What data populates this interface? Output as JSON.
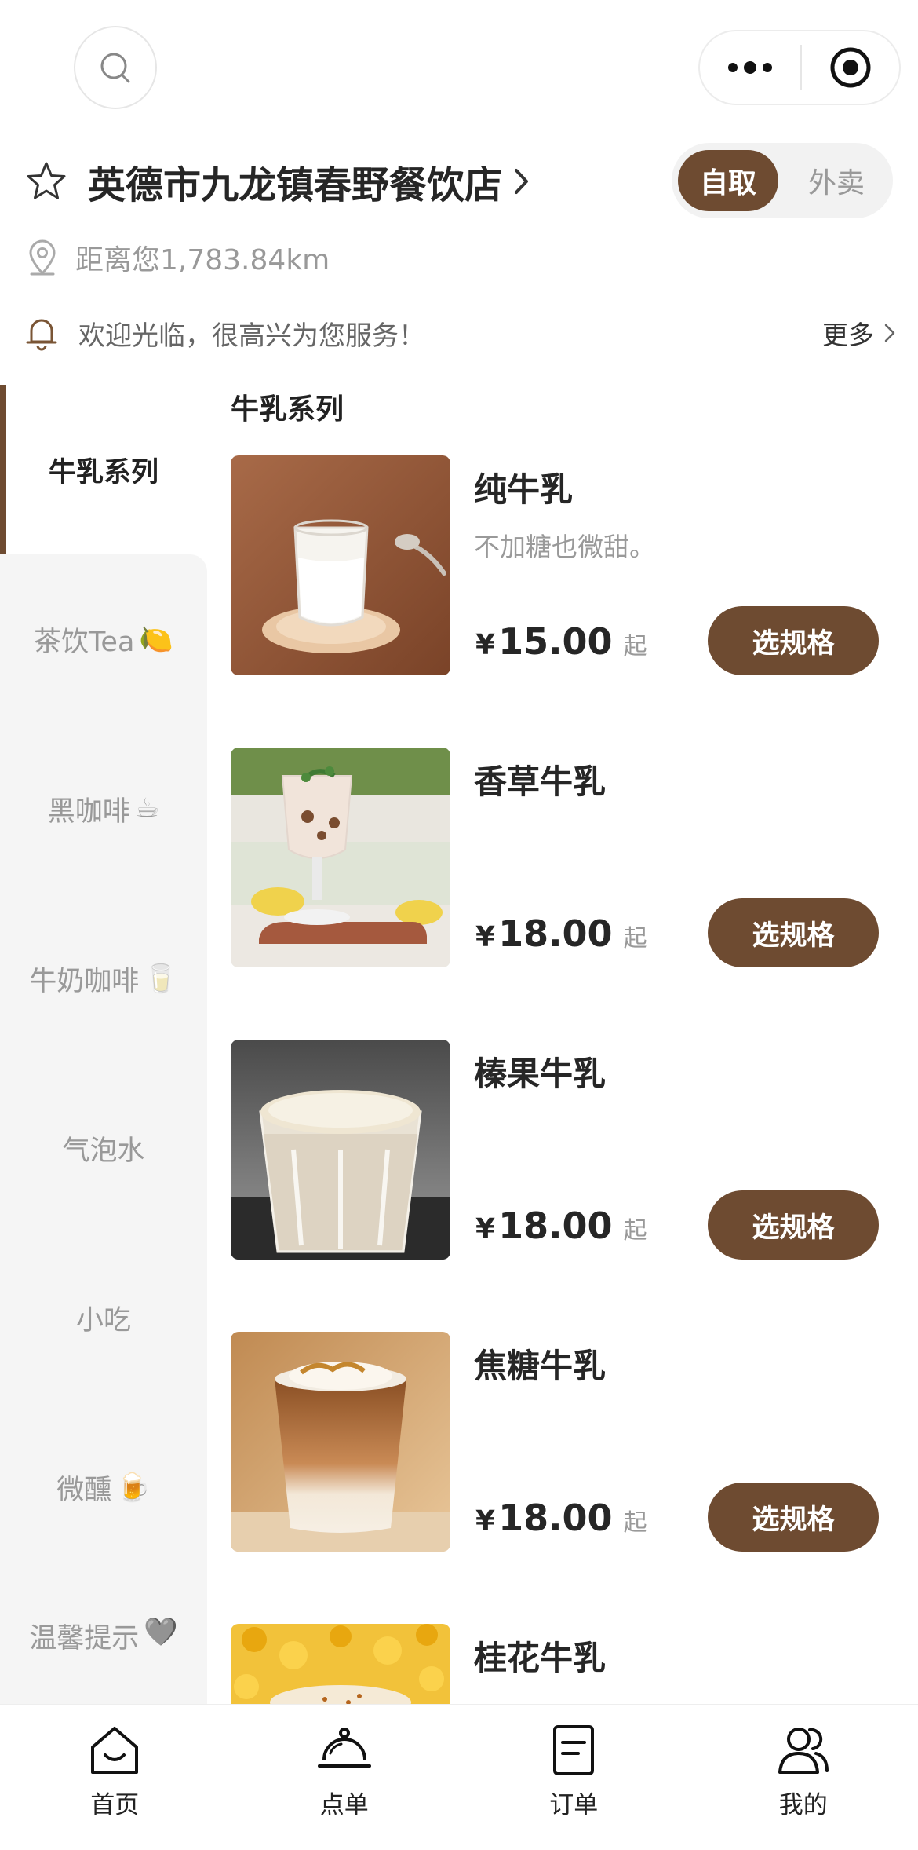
{
  "header": {
    "search_icon": "search-icon",
    "menu_icon": "more-dots-icon",
    "close_icon": "target-circle-icon"
  },
  "store": {
    "name": "英德市九龙镇春野餐饮店",
    "favorite_icon": "star-outline-icon",
    "distance": "距离您1,783.84km",
    "notice": "欢迎光临，很高兴为您服务！",
    "notice_more": "更多",
    "modes": [
      "自取",
      "外卖"
    ],
    "active_mode": "自取"
  },
  "sidebar": {
    "items": [
      {
        "label": "牛乳系列",
        "emoji": ""
      },
      {
        "label": "茶饮Tea",
        "emoji": "🍋"
      },
      {
        "label": "黑咖啡",
        "emoji": "☕"
      },
      {
        "label": "牛奶咖啡",
        "emoji": "🥛"
      },
      {
        "label": "气泡水",
        "emoji": ""
      },
      {
        "label": "小吃",
        "emoji": ""
      },
      {
        "label": "微醺",
        "emoji": "🍺"
      },
      {
        "label": "温馨提示",
        "emoji": "🩶"
      }
    ],
    "active_index": 0
  },
  "menu": {
    "section_title": "牛乳系列",
    "currency": "¥",
    "price_suffix": "起",
    "spec_button": "选规格",
    "products": [
      {
        "name": "纯牛乳",
        "desc": "不加糖也微甜。",
        "price": "15.00"
      },
      {
        "name": "香草牛乳",
        "desc": "",
        "price": "18.00"
      },
      {
        "name": "榛果牛乳",
        "desc": "",
        "price": "18.00"
      },
      {
        "name": "焦糖牛乳",
        "desc": "",
        "price": "18.00"
      },
      {
        "name": "桂花牛乳",
        "desc": "",
        "price": ""
      }
    ]
  },
  "tabbar": {
    "tabs": [
      {
        "label": "首页",
        "icon": "home-icon"
      },
      {
        "label": "点单",
        "icon": "cloche-icon"
      },
      {
        "label": "订单",
        "icon": "order-list-icon"
      },
      {
        "label": "我的",
        "icon": "users-icon"
      }
    ]
  },
  "colors": {
    "accent": "#6e4b31",
    "sidebar_bg": "#f5f5f5",
    "muted_text": "#999999"
  }
}
